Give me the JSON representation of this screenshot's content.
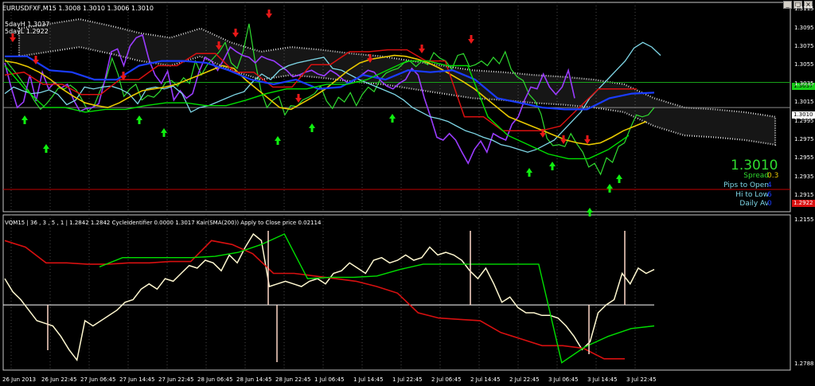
{
  "main_header": "EURUSDFXF,M15  1.3008 1.3010 1.3006 1.3010",
  "day_high": "5dayH 1.3037",
  "day_low": "5dayL 1.2922",
  "sub_header": "VQM15 | 36 , 3 , 5 , 1 | 1.2842 1.2842   CycleIdentifier 0.0000 1.3017   Kair(SMA(200)) Apply to Close price 0.02114",
  "price_big": "1.3010",
  "info_labels": [
    "Spread",
    "Pips to Open",
    "Hi to Low",
    "Daily Av"
  ],
  "info_values": [
    "0.3",
    "4",
    "6",
    "0"
  ],
  "colors": {
    "price": "#2fdc2f",
    "purple": "#9a3cff",
    "cyan": "#7fd8e8",
    "yellow": "#e8c800",
    "red": "#d81010",
    "blue": "#1a3cff",
    "green": "#00e000",
    "cream": "#fff8d0",
    "cloud": "#e6e6e6"
  },
  "chart_data": [
    {
      "type": "line",
      "title": "EURUSDFXF,M15",
      "ylim": [
        1.2898,
        1.3123
      ],
      "y_ticks": [
        "1.3115",
        "1.3095",
        "1.3075",
        "1.3055",
        "1.3035",
        "1.3015",
        "1.2995",
        "1.2975",
        "1.2955",
        "1.2935",
        "1.2915"
      ],
      "price_labels": [
        "1.3037",
        "1.3010",
        "1.2922"
      ],
      "x_ticks": [
        "26 Jun 2013",
        "26 Jun 22:45",
        "27 Jun 06:45",
        "27 Jun 14:45",
        "27 Jun 22:45",
        "28 Jun 06:45",
        "28 Jun 14:45",
        "28 Jun 22:45",
        "1 Jul 06:45",
        "1 Jul 14:45",
        "1 Jul 22:45",
        "2 Jul 06:45",
        "2 Jul 14:45",
        "2 Jul 22:45",
        "3 Jul 06:45",
        "3 Jul 14:45",
        "3 Jul 22:45"
      ],
      "series": [
        {
          "key": "price",
          "values": [
            1.3062,
            1.3054,
            1.3046,
            1.3037,
            1.3028,
            1.3017,
            1.3008,
            1.3014,
            1.3022,
            1.3031,
            1.303,
            1.3034,
            1.3029,
            1.3018,
            1.3006,
            1.3012,
            1.3028,
            1.3041,
            1.3063,
            1.3046,
            1.3022,
            1.303,
            1.3035,
            1.3018,
            1.3023,
            1.3021,
            1.3027,
            1.3037,
            1.3039,
            1.3033,
            1.3042,
            1.3036,
            1.306,
            1.3045,
            1.3056,
            1.3063,
            1.307,
            1.308,
            1.3058,
            1.3052,
            1.307,
            1.31,
            1.306,
            1.3028,
            1.301,
            1.3018,
            1.3022,
            1.3002,
            1.3012,
            1.3011,
            1.3018,
            1.3021,
            1.3025,
            1.3033,
            1.3017,
            1.3009,
            1.3021,
            1.3016,
            1.3026,
            1.3012,
            1.3024,
            1.3032,
            1.3027,
            1.304,
            1.3047,
            1.305,
            1.3052,
            1.3058,
            1.306,
            1.3054,
            1.306,
            1.3056,
            1.3069,
            1.3063,
            1.306,
            1.3051,
            1.3066,
            1.3068,
            1.3054,
            1.3056,
            1.306,
            1.3055,
            1.3064,
            1.3057,
            1.307,
            1.3051,
            1.3043,
            1.3039,
            1.3024,
            1.3017,
            1.3003,
            1.2977,
            1.2969,
            1.297,
            1.2968,
            1.2982,
            1.2971,
            1.2962,
            1.2946,
            1.295,
            1.2938,
            1.2956,
            1.2951,
            1.2968,
            1.2972,
            1.2988,
            1.3002,
            1.3,
            1.3002,
            1.301
          ]
        },
        {
          "key": "purple",
          "values": [
            1.3058,
            1.3032,
            1.301,
            1.3016,
            1.3045,
            1.3017,
            1.3048,
            1.303,
            1.3037,
            1.3031,
            1.3035,
            1.3018,
            1.3006,
            1.3009,
            1.301,
            1.3014,
            1.304,
            1.307,
            1.3073,
            1.3055,
            1.3076,
            1.3085,
            1.3088,
            1.3062,
            1.3045,
            1.3036,
            1.3049,
            1.3018,
            1.3028,
            1.302,
            1.3025,
            1.3048,
            1.3064,
            1.306,
            1.305,
            1.3062,
            1.3075,
            1.307,
            1.3066,
            1.3064,
            1.3058,
            1.3065,
            1.3062,
            1.306,
            1.3055,
            1.305,
            1.3043,
            1.3045,
            1.3048,
            1.305,
            1.3046,
            1.3044,
            1.305,
            1.3046,
            1.304,
            1.3036,
            1.304,
            1.3045,
            1.305,
            1.3048,
            1.3039,
            1.3033,
            1.303,
            1.3036,
            1.304,
            1.3052,
            1.3045,
            1.302,
            1.3,
            1.2978,
            1.2975,
            1.2982,
            1.2975,
            1.2962,
            1.295,
            1.2965,
            1.2974,
            1.2962,
            1.2982,
            1.2978,
            1.2975,
            1.2992,
            1.3,
            1.3018,
            1.3032,
            1.303,
            1.3046,
            1.3032,
            1.3024,
            1.3032,
            1.305,
            1.302
          ]
        },
        {
          "key": "cyan",
          "values": [
            1.3025,
            1.3032,
            1.3028,
            1.3025,
            1.3026,
            1.3029,
            1.3024,
            1.3013,
            1.3018,
            1.3032,
            1.303,
            1.3032,
            1.3033,
            1.303,
            1.3025,
            1.3014,
            1.303,
            1.3032,
            1.303,
            1.3033,
            1.3025,
            1.3005,
            1.301,
            1.3012,
            1.3016,
            1.302,
            1.3024,
            1.3027,
            1.3038,
            1.3046,
            1.304,
            1.305,
            1.3055,
            1.3058,
            1.306,
            1.3062,
            1.3064,
            1.3052,
            1.305,
            1.3045,
            1.304,
            1.3036,
            1.3032,
            1.3028,
            1.3024,
            1.3018,
            1.301,
            1.3005,
            1.3,
            1.2998,
            1.2995,
            1.299,
            1.2985,
            1.2982,
            1.2978,
            1.2975,
            1.297,
            1.2968,
            1.2965,
            1.2962,
            1.2965,
            1.297,
            1.2975,
            1.2985,
            1.2995,
            1.3005,
            1.302,
            1.303,
            1.304,
            1.305,
            1.306,
            1.3074,
            1.308,
            1.3075,
            1.3066
          ]
        },
        {
          "key": "yellow",
          "values": [
            1.306,
            1.3058,
            1.3054,
            1.3048,
            1.304,
            1.303,
            1.3022,
            1.3015,
            1.3012,
            1.301,
            1.3015,
            1.3022,
            1.3028,
            1.303,
            1.3032,
            1.3035,
            1.304,
            1.3045,
            1.305,
            1.3055,
            1.3052,
            1.304,
            1.303,
            1.302,
            1.301,
            1.3008,
            1.3015,
            1.3022,
            1.303,
            1.304,
            1.305,
            1.3058,
            1.3062,
            1.3064,
            1.3066,
            1.3065,
            1.3062,
            1.3058,
            1.3052,
            1.3045,
            1.3038,
            1.303,
            1.302,
            1.301,
            1.3,
            1.2995,
            1.299,
            1.2985,
            1.298,
            1.2975,
            1.2972,
            1.297,
            1.2972,
            1.2978,
            1.2985,
            1.299,
            1.2995
          ]
        },
        {
          "key": "red",
          "values": [
            1.3045,
            1.3048,
            1.3035,
            1.3035,
            1.3024,
            1.3024,
            1.304,
            1.304,
            1.3055,
            1.3055,
            1.3068,
            1.3068,
            1.3048,
            1.3048,
            1.3032,
            1.3032,
            1.3056,
            1.3056,
            1.307,
            1.307,
            1.3072,
            1.3072,
            1.306,
            1.306,
            1.3,
            1.3,
            1.2985,
            1.2985,
            1.2985,
            1.299,
            1.301,
            1.303,
            1.303,
            1.303
          ]
        },
        {
          "key": "blue",
          "values": [
            1.3065,
            1.3065,
            1.305,
            1.3048,
            1.304,
            1.304,
            1.3055,
            1.306,
            1.306,
            1.3058,
            1.305,
            1.304,
            1.3035,
            1.304,
            1.303,
            1.3032,
            1.3045,
            1.304,
            1.305,
            1.3048,
            1.305,
            1.304,
            1.302,
            1.3015,
            1.301,
            1.3008,
            1.3008,
            1.302,
            1.3025,
            1.3026
          ]
        },
        {
          "key": "green",
          "values": [
            1.3055,
            1.303,
            1.301,
            1.301,
            1.3005,
            1.3008,
            1.3008,
            1.3012,
            1.3015,
            1.3015,
            1.3012,
            1.3012,
            1.3018,
            1.3025,
            1.303,
            1.303,
            1.3035,
            1.3035,
            1.304,
            1.305,
            1.306,
            1.306,
            1.3055,
            1.3055,
            1.3,
            1.298,
            1.297,
            1.296,
            1.2955,
            1.2955,
            1.2965,
            1.298
          ]
        }
      ],
      "hlines": [
        1.3037,
        1.301,
        1.2922
      ]
    },
    {
      "type": "line",
      "title": "VQM15",
      "ylim": [
        1.2768,
        1.3159
      ],
      "y_ticks": [
        "1.2155",
        "1.2788"
      ],
      "series": [
        {
          "key": "cream",
          "values": [
            0.66,
            0.56,
            0.5,
            0.42,
            0.34,
            0.32,
            0.3,
            0.22,
            0.12,
            0.04,
            0.34,
            0.3,
            0.34,
            0.38,
            0.42,
            0.48,
            0.5,
            0.58,
            0.62,
            0.58,
            0.66,
            0.64,
            0.7,
            0.76,
            0.74,
            0.8,
            0.78,
            0.72,
            0.84,
            0.78,
            0.9,
            1.0,
            0.95,
            0.6,
            0.62,
            0.64,
            0.62,
            0.6,
            0.64,
            0.66,
            0.62,
            0.7,
            0.72,
            0.78,
            0.74,
            0.7,
            0.8,
            0.82,
            0.78,
            0.8,
            0.84,
            0.8,
            0.82,
            0.9,
            0.84,
            0.86,
            0.84,
            0.8,
            0.72,
            0.66,
            0.74,
            0.62,
            0.48,
            0.52,
            0.44,
            0.4,
            0.4,
            0.38,
            0.38,
            0.36,
            0.3,
            0.22,
            0.12,
            0.18,
            0.4,
            0.46,
            0.5,
            0.7,
            0.62,
            0.74,
            0.7,
            0.73
          ]
        },
        {
          "key": "red",
          "values": [
            0.95,
            0.9,
            0.78,
            0.78,
            0.77,
            0.77,
            0.78,
            0.78,
            0.79,
            0.79,
            0.95,
            0.92,
            0.85,
            0.7,
            0.7,
            0.68,
            0.66,
            0.64,
            0.6,
            0.55,
            0.4,
            0.36,
            0.35,
            0.34,
            0.25,
            0.2,
            0.15,
            0.15,
            0.13,
            0.05,
            0.05
          ]
        },
        {
          "key": "green",
          "values": [
            0.75,
            0.82,
            0.82,
            0.82,
            0.82,
            0.83,
            0.86,
            0.92,
            1.0,
            0.66,
            0.67,
            0.67,
            0.68,
            0.73,
            0.77,
            0.77,
            0.77,
            0.77,
            0.77,
            0.77,
            0.02,
            0.14,
            0.22,
            0.28,
            0.3
          ]
        }
      ]
    }
  ]
}
